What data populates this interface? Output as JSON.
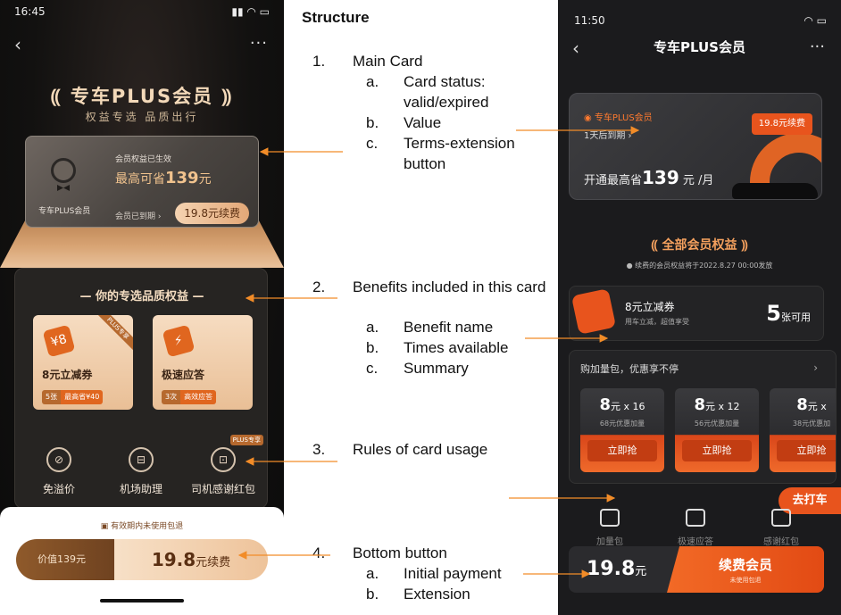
{
  "left_phone": {
    "status_time": "16:45",
    "back_icon": "chevron-left-icon",
    "more_icon": "ellipsis-icon",
    "hero_title": "专车PLUS会员",
    "hero_subtitle": "权益专选 品质出行",
    "main_card": {
      "member_name": "专车PLUS会员",
      "status_text": "会员权益已生效",
      "saving_prefix": "最高可省",
      "saving_amount": "139",
      "saving_unit": "元",
      "expired_text": "会员已到期 ›",
      "renew_button": "19.8元续费"
    },
    "benefits_title": "你的专选品质权益",
    "benefit_cards": [
      {
        "name": "8元立减券",
        "ribbon": "PLUS专享",
        "icon": "¥8",
        "tag1": "5张",
        "tag2": "最高省¥40"
      },
      {
        "name": "极速应答",
        "ribbon": "",
        "icon": "⚡",
        "tag1": "3次",
        "tag2": "高效应答"
      }
    ],
    "rules": [
      {
        "label": "免溢价",
        "icon": "no-surge-icon",
        "badge": ""
      },
      {
        "label": "机场助理",
        "icon": "car-icon",
        "badge": ""
      },
      {
        "label": "司机感谢红包",
        "icon": "red-packet-icon",
        "badge": "PLUS专享"
      }
    ],
    "bottom_note": "有效期内未使用包退",
    "bottom_value": "价值139元",
    "bottom_price": "19.8",
    "bottom_action": "元续费"
  },
  "annotations": {
    "heading": "Structure",
    "items": [
      {
        "num": "1.",
        "text": "Main Card",
        "subs": [
          {
            "k": "a.",
            "t": "Card status: valid/expired"
          },
          {
            "k": "b.",
            "t": "Value"
          },
          {
            "k": "c.",
            "t": "Terms-extension button"
          }
        ]
      },
      {
        "num": "2.",
        "text": "Benefits included in this card",
        "subs": [
          {
            "k": "a.",
            "t": "Benefit name"
          },
          {
            "k": "b.",
            "t": "Times available"
          },
          {
            "k": "c.",
            "t": "Summary"
          }
        ]
      },
      {
        "num": "3.",
        "text": "Rules of card usage",
        "subs": []
      },
      {
        "num": "4.",
        "text": "Bottom button",
        "subs": [
          {
            "k": "a.",
            "t": "Initial payment"
          },
          {
            "k": "b.",
            "t": "Extension"
          }
        ]
      }
    ]
  },
  "right_phone": {
    "status_time": "11:50",
    "title": "专车PLUS会员",
    "card": {
      "brand": "专车PLUS会员",
      "expire": "1天后到期 ›",
      "renew_button": "19.8元续费",
      "save_prefix": "开通最高省",
      "save_amount": "139",
      "save_unit": "元 /月"
    },
    "all_benefits": "全部会员权益",
    "renew_note": "续费的会员权益将于2022.8.27 00:00发放",
    "coupon": {
      "name": "8元立减券",
      "desc": "用车立减，超值享受",
      "count": "5",
      "unit": "张可用"
    },
    "buy_title": "购加量包，优惠享不停",
    "packs": [
      {
        "value": "8",
        "mult": "元 x 16",
        "desc": "68元优惠加量",
        "button": "立即抢"
      },
      {
        "value": "8",
        "mult": "元 x 12",
        "desc": "56元优惠加量",
        "button": "立即抢"
      },
      {
        "value": "8",
        "mult": "元 x",
        "desc": "38元优惠加",
        "button": "立即抢"
      }
    ],
    "taxi_button": "去打车",
    "bottom_icons": [
      {
        "label": "加量包",
        "icon": "ticket-icon"
      },
      {
        "label": "极速应答",
        "icon": "lightning-icon"
      },
      {
        "label": "感谢红包",
        "icon": "red-packet-icon"
      }
    ],
    "bottom_price": "19.8",
    "bottom_price_unit": "元",
    "bottom_action": "续费会员",
    "bottom_action_sub": "未使用包退"
  },
  "colors": {
    "accent": "#F28C28",
    "brand_orange": "#E8541D",
    "gold": "#F1C38E"
  }
}
